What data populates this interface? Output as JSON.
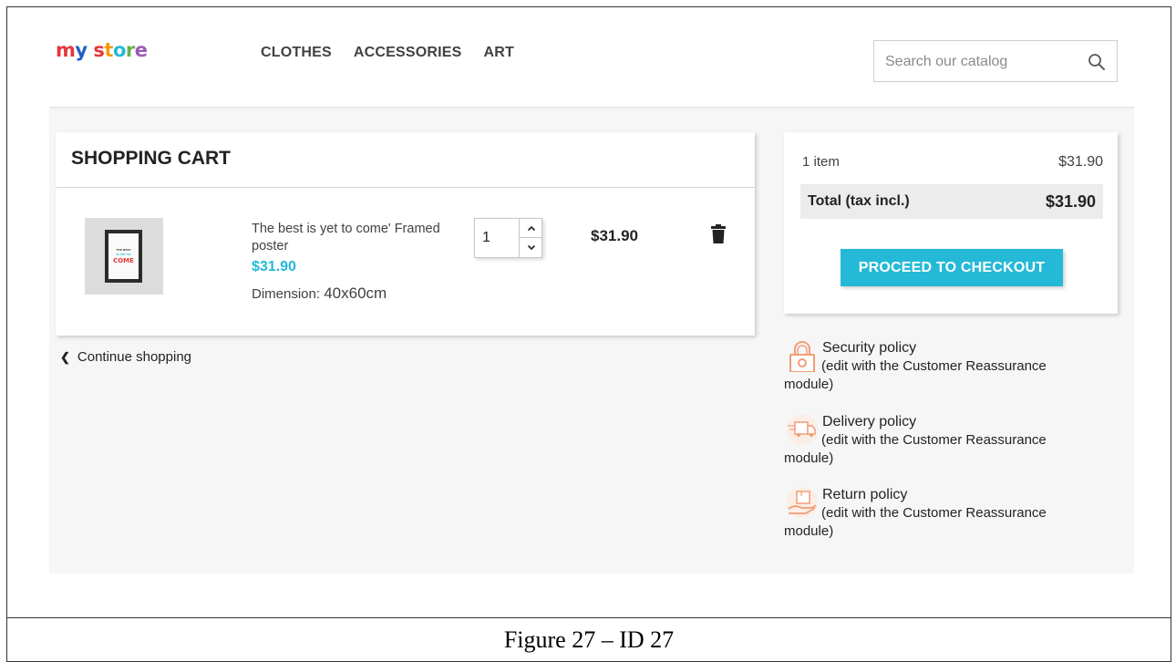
{
  "header": {
    "logo": {
      "letters": [
        "m",
        "y",
        " ",
        "s",
        "t",
        "o",
        "r",
        "e"
      ],
      "colors": [
        "#e5373d",
        "#1e5fbf",
        "#fff",
        "#e5373d",
        "#f39c12",
        "#24b9d7",
        "#6ab04c",
        "#9b59b6"
      ]
    },
    "nav": [
      "CLOTHES",
      "ACCESSORIES",
      "ART"
    ],
    "search_placeholder": "Search our catalog"
  },
  "cart": {
    "title": "SHOPPING CART",
    "product": {
      "name": "The best is yet to come' Framed poster",
      "price": "$31.90",
      "attr_label": "Dimension:",
      "attr_value": "40x60cm",
      "quantity": "1",
      "line_total": "$31.90",
      "poster_lines": [
        "THE BEST",
        "IS YET TO",
        "COME"
      ]
    },
    "continue_label": "Continue shopping"
  },
  "summary": {
    "items_label": "1 item",
    "items_amount": "$31.90",
    "total_label": "Total (tax incl.)",
    "total_amount": "$31.90",
    "checkout_label": "PROCEED TO CHECKOUT"
  },
  "reassurance": [
    {
      "title": "Security policy",
      "desc": "(edit with the Customer Reassurance module)",
      "icon": "lock-icon"
    },
    {
      "title": "Delivery policy",
      "desc": "(edit with the Customer Reassurance module)",
      "icon": "truck-icon"
    },
    {
      "title": "Return policy",
      "desc": "(edit with the Customer Reassurance module)",
      "icon": "return-box-icon"
    }
  ],
  "caption": "Figure 27 – ID 27",
  "colors": {
    "accent": "#24b9d7",
    "background": "#f6f6f6"
  }
}
